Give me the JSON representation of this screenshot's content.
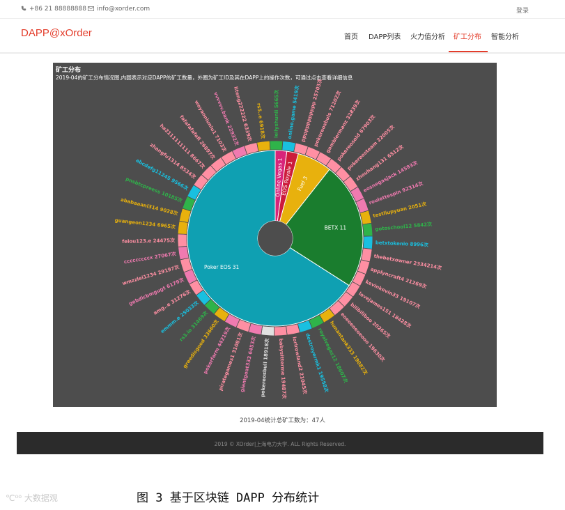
{
  "topbar": {
    "phone": "+86 21 88888888",
    "email": "info@xorder.com",
    "login": "登录"
  },
  "nav": {
    "brand": "DAPP@xOrder",
    "items": [
      "首页",
      "DAPP列表",
      "火力值分析",
      "矿工分布",
      "智能分析"
    ],
    "active_index": 3
  },
  "colors": {
    "brand": "#e33d2b",
    "panel_bg": "#4d4d4d",
    "footer_bg": "#2b2b2b"
  },
  "chart": {
    "title": "矿工分布",
    "subtitle": "2019-04的矿工分布情况图,内圆表示对应DAPP的矿工数量，外圈为矿工ID及其在DAPP上的操作次数，可通过点击查看详细信息"
  },
  "chart_data": {
    "type": "sunburst",
    "inner": [
      {
        "name": "Poker EOS",
        "value": 31,
        "color": "#0fa0b2"
      },
      {
        "name": "BETX",
        "value": 11,
        "color": "#1a7d2e"
      },
      {
        "name": "Fuel",
        "value": 3,
        "color": "#e8b10d"
      },
      {
        "name": "EOS Royale",
        "value": 1,
        "color": "#cc1b3b"
      },
      {
        "name": "Online Vegas",
        "value": 1,
        "color": "#d8247a"
      }
    ],
    "outer": [
      {
        "label": "royalvegas12 18607次",
        "color": "#2fb34a"
      },
      {
        "label": "destroyermk1 19558次",
        "color": "#19c0e0"
      },
      {
        "label": "lorirowland2 21045次",
        "color": "#ff8fa3"
      },
      {
        "label": "babysitterme 19487次",
        "color": "#ff8fa3"
      },
      {
        "label": "pokereosbull 18918次",
        "color": "#e0e0e0"
      },
      {
        "label": "giantgoat333 6453次",
        "color": "#f07ab0"
      },
      {
        "label": "pirategames1 31081次",
        "color": "#ff8fa3"
      },
      {
        "label": "pokerfarm 44219次",
        "color": "#f07ab0"
      },
      {
        "label": "greedisgood 33660次",
        "color": "#e8b10d"
      },
      {
        "label": "rs3.io 31469次",
        "color": "#2fb34a"
      },
      {
        "label": "emmm.e 25033次",
        "color": "#19c0e0"
      },
      {
        "label": "amg..e 31276次",
        "color": "#ff8fa3"
      },
      {
        "label": "gebdicbmgugt 6179次",
        "color": "#f07ab0"
      },
      {
        "label": "wmzzlei1234 29197次",
        "color": "#ff8fa3"
      },
      {
        "label": "cccccccccx 27067次",
        "color": "#f07ab0"
      },
      {
        "label": "felou123.e 24475次",
        "color": "#ff8fa3"
      },
      {
        "label": "guangeon1234 6965次",
        "color": "#e8b10d"
      },
      {
        "label": "ababaaanl314 9028次",
        "color": "#e8b10d"
      },
      {
        "label": "pnsbtcpreess 10185次",
        "color": "#2fb34a"
      },
      {
        "label": "abcdefg11245 9566次",
        "color": "#19c0e0"
      },
      {
        "label": "zhangfu1314 8534次",
        "color": "#ff8fa3"
      },
      {
        "label": "ha2111111111 8667次",
        "color": "#ff8fa3"
      },
      {
        "label": "fafafafafafi 26897次",
        "color": "#ff8fa3"
      },
      {
        "label": "woyaoniuniu1 7103次",
        "color": "#ff8fa3"
      },
      {
        "label": "vvvvvv.bank 22932次",
        "color": "#f07ab0"
      },
      {
        "label": "liteng222222 6339次",
        "color": "#ff8fa3"
      },
      {
        "label": "rs5..e 6918次",
        "color": "#e8b10d"
      },
      {
        "label": "leilyshunli 5665次",
        "color": "#2fb34a"
      },
      {
        "label": "online.game 5419次",
        "color": "#19c0e0"
      },
      {
        "label": "pppppppppppp 25703次",
        "color": "#ff8fa3"
      },
      {
        "label": "pokereosbuls 71202次",
        "color": "#ff8fa3"
      },
      {
        "label": "gamblermanz 32839次",
        "color": "#ff8fa3"
      },
      {
        "label": "pokereosold 67903次",
        "color": "#ff8fa3"
      },
      {
        "label": "pokereosteam 22005次",
        "color": "#ff8fa3"
      },
      {
        "label": "zhouhang131 6512次",
        "color": "#ff8fa3"
      },
      {
        "label": "eosnegasjack 14593次",
        "color": "#f07ab0"
      },
      {
        "label": "roulettespin 92314次",
        "color": "#f07ab0"
      },
      {
        "label": "testliupyuan 2051次",
        "color": "#e8b10d"
      },
      {
        "label": "gotoschool12 5842次",
        "color": "#2fb34a"
      },
      {
        "label": "betxtokenio 8996次",
        "color": "#19c0e0"
      },
      {
        "label": "thebetxowner 2334214次",
        "color": "#ff8fa3"
      },
      {
        "label": "applyncraft4 21269次",
        "color": "#ff8fa3"
      },
      {
        "label": "kevinkevin33 19107次",
        "color": "#ff8fa3"
      },
      {
        "label": "lovejames151 18428次",
        "color": "#ff8fa3"
      },
      {
        "label": "bilibiliboo 20265次",
        "color": "#ff8fa3"
      },
      {
        "label": "eoeoeoeoeooo 19630次",
        "color": "#ff8fa3"
      },
      {
        "label": "hunantank333 19082次",
        "color": "#e8b10d"
      }
    ]
  },
  "summary": "2019-04统计总矿工数为：47人",
  "footer": "2019 © XOrder|上海电力大学. ALL Rights Reserved.",
  "caption": "图 3  基于区块链 DAPP 分布统计",
  "watermark": "大数据观"
}
